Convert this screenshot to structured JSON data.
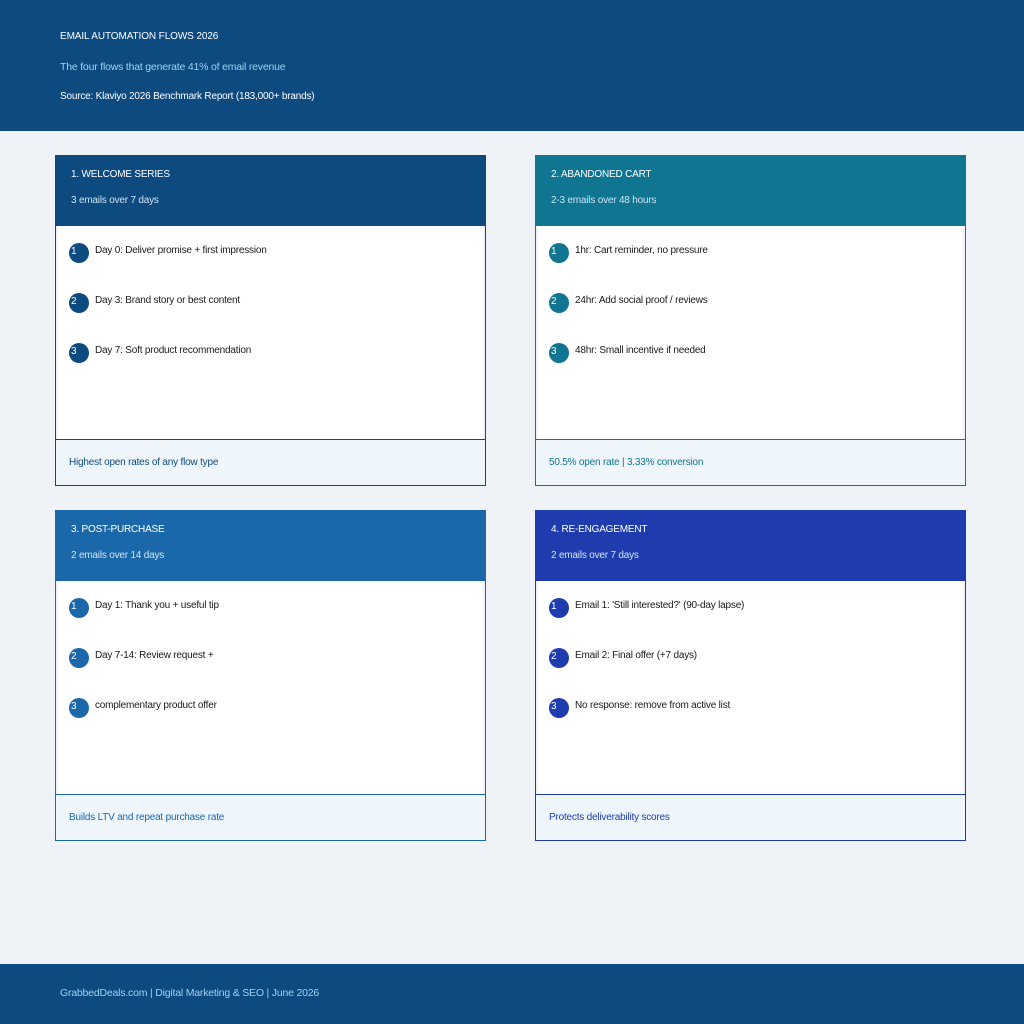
{
  "header": {
    "title": "EMAIL AUTOMATION FLOWS 2026",
    "subtitle": "The four flows that generate 41% of email revenue",
    "source": "Source: Klaviyo 2026 Benchmark Report (183,000+ brands)"
  },
  "flows": [
    {
      "title": "1. WELCOME SERIES",
      "subtitle": "3 emails over 7 days",
      "color": "#0d4a80",
      "steps": [
        {
          "num": "1",
          "text": "Day 0: Deliver promise + first impression"
        },
        {
          "num": "2",
          "text": "Day 3: Brand story or best content"
        },
        {
          "num": "3",
          "text": "Day 7: Soft product recommendation"
        }
      ],
      "footer": "Highest open rates of any flow type"
    },
    {
      "title": "2. ABANDONED CART",
      "subtitle": "2-3 emails over 48 hours",
      "color": "#0f7590",
      "steps": [
        {
          "num": "1",
          "text": "1hr: Cart reminder, no pressure"
        },
        {
          "num": "2",
          "text": "24hr: Add social proof / reviews"
        },
        {
          "num": "3",
          "text": "48hr: Small incentive if needed"
        }
      ],
      "footer": "50.5% open rate | 3.33% conversion"
    },
    {
      "title": "3. POST-PURCHASE",
      "subtitle": "2 emails over 14 days",
      "color": "#1a68aa",
      "steps": [
        {
          "num": "1",
          "text": "Day 1: Thank you + useful tip"
        },
        {
          "num": "2",
          "text": "Day 7-14: Review request +"
        },
        {
          "num": "3",
          "text": "complementary product offer"
        }
      ],
      "footer": "Builds LTV and repeat purchase rate"
    },
    {
      "title": "4. RE-ENGAGEMENT",
      "subtitle": "2 emails over 7 days",
      "color": "#1f3caf",
      "steps": [
        {
          "num": "1",
          "text": "Email 1: 'Still interested?' (90-day lapse)"
        },
        {
          "num": "2",
          "text": "Email 2: Final offer (+7 days)"
        },
        {
          "num": "3",
          "text": "No response: remove from active list"
        }
      ],
      "footer": "Protects deliverability scores"
    }
  ],
  "footer": {
    "text": "GrabbedDeals.com  |  Digital Marketing & SEO  |  June 2026"
  }
}
